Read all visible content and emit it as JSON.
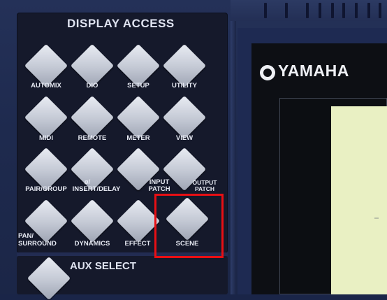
{
  "panel_title": "DISPLAY ACCESS",
  "buttons": {
    "automix": "AUTOMIX",
    "dio": "DIO",
    "setup": "SETUP",
    "utility": "UTILITY",
    "midi": "MIDI",
    "remote": "REMOTE",
    "meter": "METER",
    "view": "VIEW",
    "pair_group": "PAIR/GROUP",
    "insert_delay_1": "ø/",
    "insert_delay_2": "INSERT/DELAY",
    "input_patch_1": "INPUT",
    "input_patch_2": "PATCH",
    "output_patch_1": "OUTPUT",
    "output_patch_2": "PATCH",
    "pan_surround_1": "PAN/",
    "pan_surround_2": "SURROUND",
    "dynamics": "DYNAMICS",
    "effect": "EFFECT",
    "scene": "SCENE"
  },
  "aux_title": "AUX SELECT",
  "brand": "YAMAHA",
  "highlight_color": "#e80f14",
  "colors": {
    "console_blue": "#243158",
    "panel_dark": "#15192b",
    "button_silver": "#c3c8d4",
    "lcd": "#e9f0c3"
  }
}
